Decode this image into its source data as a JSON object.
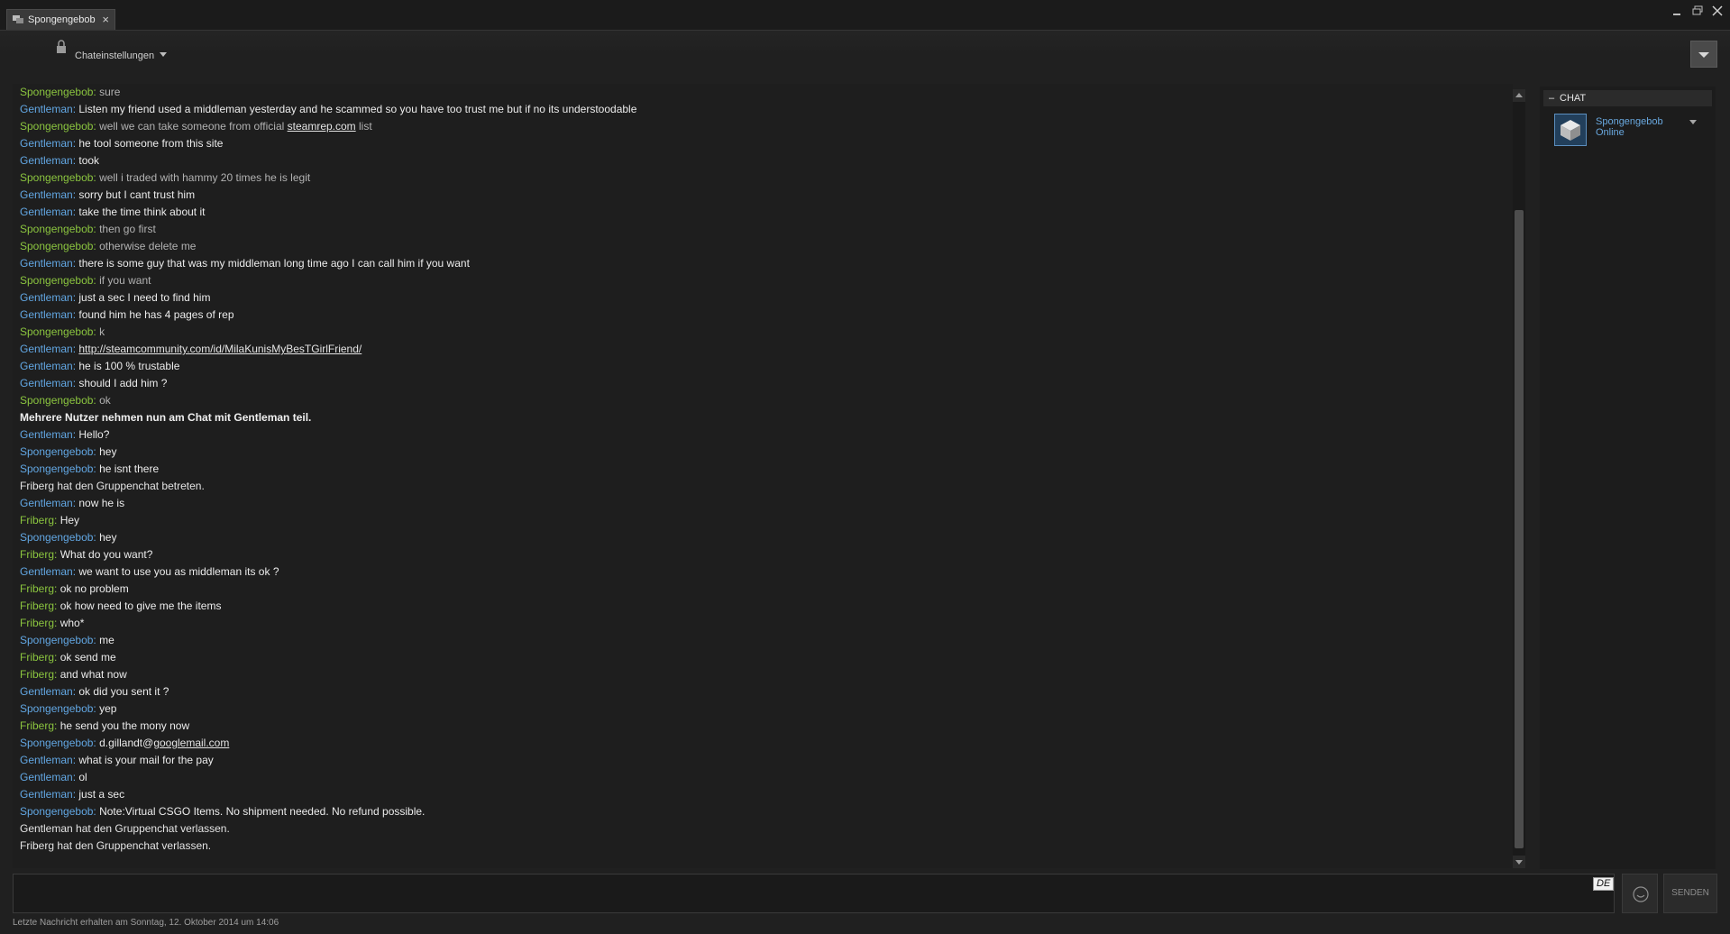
{
  "window": {
    "tab_title": "Spongengebob",
    "tab_close": "×"
  },
  "toolbar": {
    "settings_label": "Chateinstellungen"
  },
  "messages": [
    {
      "sender": "Spongengebob",
      "role": "self",
      "text": "sure"
    },
    {
      "sender": "Gentleman",
      "role": "other",
      "text": "Listen my friend used a middleman yesterday and he scammed so you have too trust me but if no its understoodable"
    },
    {
      "sender": "Spongengebob",
      "role": "self",
      "text": "well we can take someone from official ",
      "link": "steamrep.com",
      "after": " list"
    },
    {
      "sender": "Gentleman",
      "role": "other",
      "text": "he tool someone from this site"
    },
    {
      "sender": "Gentleman",
      "role": "other",
      "text": "took"
    },
    {
      "sender": "Spongengebob",
      "role": "self",
      "text": "well i traded with hammy 20 times he is legit"
    },
    {
      "sender": "Gentleman",
      "role": "other",
      "text": "sorry but I cant trust him"
    },
    {
      "sender": "Gentleman",
      "role": "other",
      "text": "take the time think about it"
    },
    {
      "sender": "Spongengebob",
      "role": "self",
      "text": "then go first"
    },
    {
      "sender": "Spongengebob",
      "role": "self",
      "text": "otherwise delete me"
    },
    {
      "sender": "Gentleman",
      "role": "other",
      "text": "there is some guy that was my middleman long time ago I can call him if you want"
    },
    {
      "sender": "Spongengebob",
      "role": "self",
      "text": "if you want"
    },
    {
      "sender": "Gentleman",
      "role": "other",
      "text": "just a sec I need to find him"
    },
    {
      "sender": "Gentleman",
      "role": "other",
      "text": "found him he has 4 pages of rep"
    },
    {
      "sender": "Spongengebob",
      "role": "self",
      "text": "k"
    },
    {
      "sender": "Gentleman",
      "role": "other",
      "text": "",
      "link": "http://steamcommunity.com/id/MilaKunisMyBesTGirlFriend/",
      "after": ""
    },
    {
      "sender": "Gentleman",
      "role": "other",
      "text": "he is 100 % trustable"
    },
    {
      "sender": "Gentleman",
      "role": "other",
      "text": "should I add him ?"
    },
    {
      "sender": "Spongengebob",
      "role": "self",
      "text": "ok"
    },
    {
      "sender": "",
      "role": "bold",
      "text": "Mehrere Nutzer nehmen nun am Chat mit Gentleman teil."
    },
    {
      "sender": "Gentleman",
      "role": "other",
      "text": "Hello?"
    },
    {
      "sender": "Spongengebob",
      "role": "self-blue",
      "text": "hey"
    },
    {
      "sender": "Spongengebob",
      "role": "self-blue",
      "text": "he isnt there"
    },
    {
      "sender": "",
      "role": "system",
      "text": "Friberg hat den Gruppenchat betreten."
    },
    {
      "sender": "Gentleman",
      "role": "other",
      "text": "now he is"
    },
    {
      "sender": "Friberg",
      "role": "friberg",
      "text": "Hey"
    },
    {
      "sender": "Spongengebob",
      "role": "self-blue",
      "text": "hey"
    },
    {
      "sender": "Friberg",
      "role": "friberg",
      "text": "What do you want?"
    },
    {
      "sender": "Gentleman",
      "role": "other",
      "text": "we want to use you as middleman its ok ?"
    },
    {
      "sender": "Friberg",
      "role": "friberg",
      "text": "ok no problem"
    },
    {
      "sender": "Friberg",
      "role": "friberg",
      "text": "ok how need to give me the items"
    },
    {
      "sender": "Friberg",
      "role": "friberg",
      "text": "who*"
    },
    {
      "sender": "Spongengebob",
      "role": "self-blue",
      "text": "me"
    },
    {
      "sender": "Friberg",
      "role": "friberg",
      "text": "ok send me"
    },
    {
      "sender": "Friberg",
      "role": "friberg",
      "text": "and what now"
    },
    {
      "sender": "Gentleman",
      "role": "other",
      "text": "ok did you sent it ?"
    },
    {
      "sender": "Spongengebob",
      "role": "self-blue",
      "text": "yep"
    },
    {
      "sender": "Friberg",
      "role": "friberg",
      "text": "he send you the mony now"
    },
    {
      "sender": "Spongengebob",
      "role": "self-blue",
      "text": "d.gillandt@",
      "link": "googlemail.com",
      "after": ""
    },
    {
      "sender": "Gentleman",
      "role": "other",
      "text": "what is your mail for the pay"
    },
    {
      "sender": "Gentleman",
      "role": "other",
      "text": "ol"
    },
    {
      "sender": "Gentleman",
      "role": "other",
      "text": "just a sec"
    },
    {
      "sender": "Spongengebob",
      "role": "self-blue",
      "text": "Note:Virtual CSGO Items. No shipment needed. No refund possible."
    },
    {
      "sender": "",
      "role": "system",
      "text": "Gentleman hat den Gruppenchat verlassen."
    },
    {
      "sender": "",
      "role": "system",
      "text": "Friberg hat den Gruppenchat verlassen."
    }
  ],
  "side_panel": {
    "header": "CHAT",
    "collapse_symbol": "–",
    "member_name": "Spongengebob",
    "member_status": "Online"
  },
  "input": {
    "value": "",
    "language_badge": "DE",
    "send_label": "SENDEN"
  },
  "status": {
    "last_message": "Letzte Nachricht erhalten am Sonntag, 12. Oktober 2014 um 14:06"
  },
  "colors": {
    "gentleman_name": "#62a7e3",
    "spongebob_name": "#8bc53f",
    "friberg_name": "#8bc53f",
    "background": "#262626"
  }
}
